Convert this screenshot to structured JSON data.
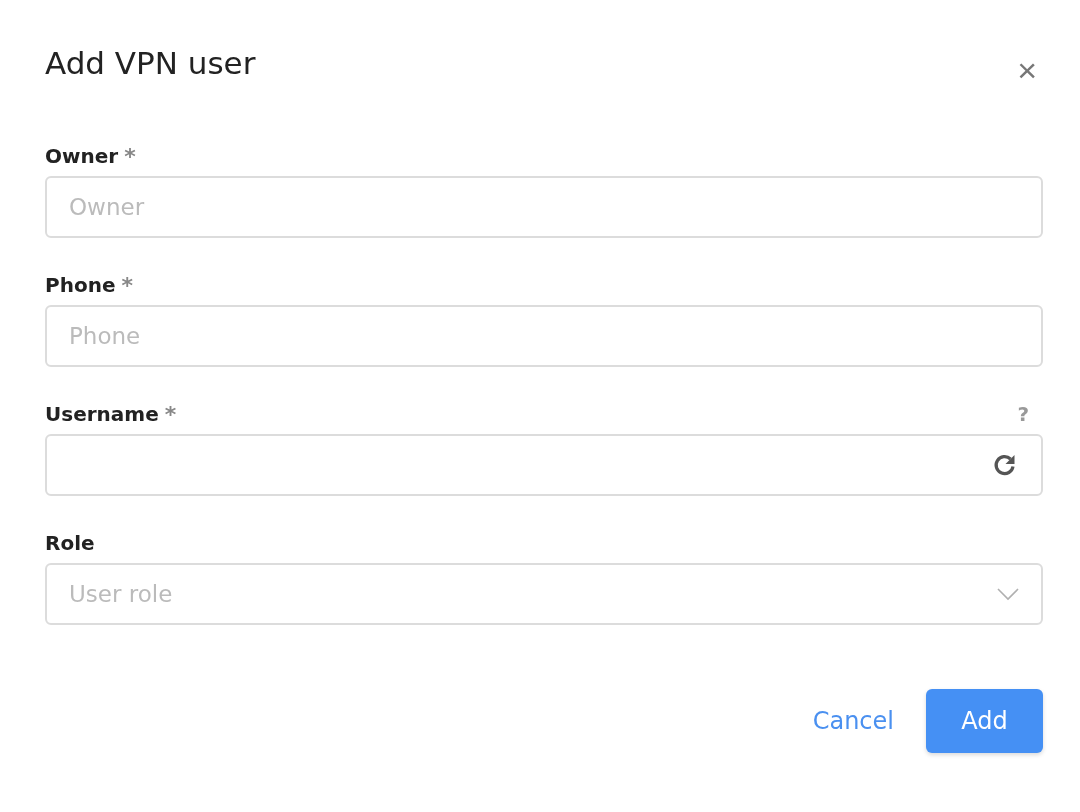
{
  "dialog": {
    "title": "Add VPN user",
    "close": "×"
  },
  "fields": [
    {
      "kind": "text",
      "label": "Owner",
      "required_mark": "*",
      "placeholder": "Owner"
    },
    {
      "kind": "text",
      "label": "Phone",
      "required_mark": "*",
      "placeholder": "Phone"
    },
    {
      "kind": "regenerate",
      "label": "Username",
      "required_mark": "*",
      "help": "?"
    },
    {
      "kind": "select",
      "label": "Role",
      "placeholder": "User role"
    }
  ],
  "buttons": [
    {
      "kind": "link",
      "label": "Cancel"
    },
    {
      "kind": "primary",
      "label": "Add"
    }
  ]
}
